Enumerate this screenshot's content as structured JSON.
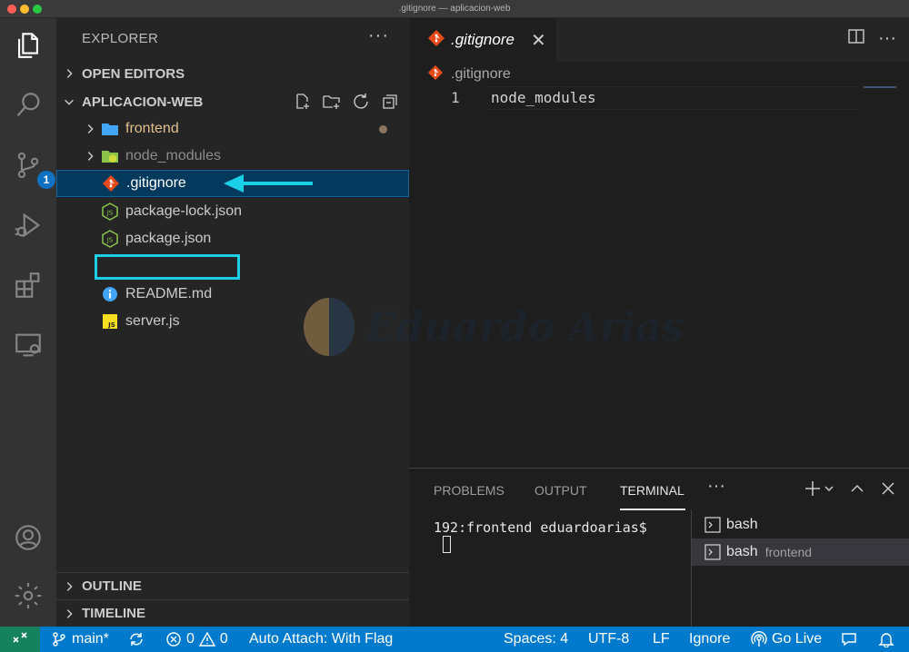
{
  "window": {
    "title": ".gitignore — aplicacion-web"
  },
  "activity": {
    "scm_badge": "1"
  },
  "explorer": {
    "header": "EXPLORER",
    "more": "···",
    "open_editors": "OPEN EDITORS",
    "folder_name": "APLICACION-WEB",
    "items": [
      {
        "label": "frontend",
        "color": "#e2c08d"
      },
      {
        "label": "node_modules",
        "color": "#8c8c8c"
      },
      {
        "label": ".gitignore",
        "color": "#ffffff"
      },
      {
        "label": "package-lock.json",
        "color": "#cccccc"
      },
      {
        "label": "package.json",
        "color": "#cccccc"
      },
      {
        "label": "README.md",
        "color": "#cccccc"
      },
      {
        "label": "server.js",
        "color": "#cccccc"
      }
    ],
    "outline": "OUTLINE",
    "timeline": "TIMELINE"
  },
  "editor": {
    "tab_label": ".gitignore",
    "tab_close": "✕",
    "more": "···",
    "breadcrumb": ".gitignore",
    "lines": [
      {
        "num": "1",
        "text": "node_modules"
      }
    ]
  },
  "watermark": "Eduardo Arias",
  "panel": {
    "tabs": [
      "PROBLEMS",
      "OUTPUT",
      "TERMINAL"
    ],
    "more": "···",
    "terminal_prompt": "192:frontend eduardoarias$",
    "terminals": [
      {
        "name": "bash",
        "sub": ""
      },
      {
        "name": "bash",
        "sub": "frontend"
      }
    ]
  },
  "status": {
    "branch": "main*",
    "errors": "0",
    "warnings": "0",
    "auto_attach": "Auto Attach: With Flag",
    "spaces": "Spaces: 4",
    "encoding": "UTF-8",
    "eol": "LF",
    "language": "Ignore",
    "go_live": "Go Live"
  },
  "colors": {
    "accent": "#007acc",
    "remote": "#16825d",
    "selection": "#04395e",
    "annotation": "#1ad0e6"
  }
}
